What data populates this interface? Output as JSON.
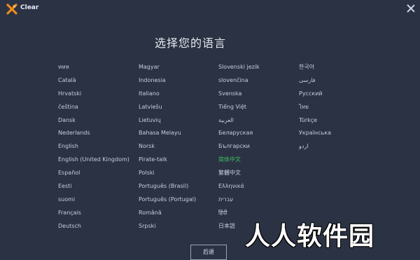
{
  "app": {
    "title": "Clear",
    "brand_color": "#f08a1c"
  },
  "heading": "选择您的语言",
  "languages": {
    "col1": [
      "หหห",
      "Català",
      "Hrvatski",
      "čeština",
      "Dansk",
      "Nederlands",
      "English",
      "English (United Kingdom)",
      "Español",
      "Eesti",
      "suomi",
      "Français",
      "Deutsch"
    ],
    "col2": [
      "Magyar",
      "Indonesia",
      "Italiano",
      "Latviešu",
      "Lietuvių",
      "Bahasa Melayu",
      "Norsk",
      "Pirate-talk",
      "Polski",
      "Português (Brasil)",
      "Português (Portugal)",
      "Română",
      "Srpski"
    ],
    "col3": [
      "Slovenski jezik",
      "slovenčina",
      "Svenska",
      "Tiếng Việt",
      "العربية",
      "Беларуская",
      "Български",
      "简体中文",
      "繁體中文",
      "Ελληνικά",
      "עברית",
      "हिंदी",
      "日本語"
    ],
    "col4": [
      "한국어",
      "فارسی",
      "Русский",
      "ไทย",
      "Türkçe",
      "Українська",
      "اردو"
    ]
  },
  "selected_language": "简体中文",
  "next_button": "后退",
  "watermark": "人人软件园"
}
